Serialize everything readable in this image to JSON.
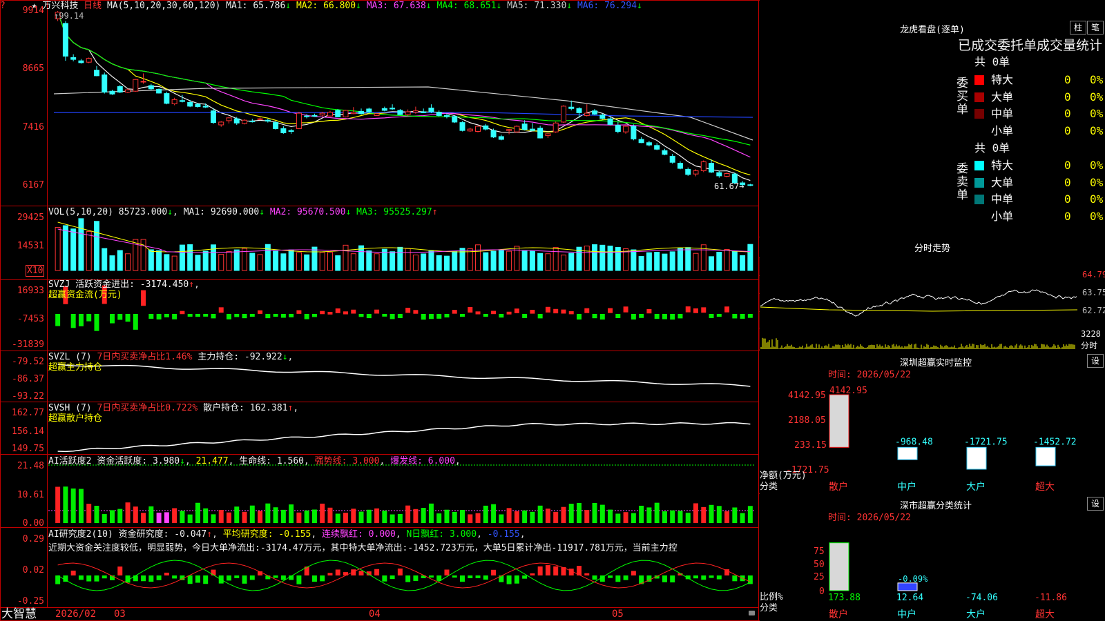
{
  "stock": {
    "star": "★",
    "name": "万兴科技",
    "period": "日线"
  },
  "ma_line": {
    "params": "MA(5,10,20,30,60,120)",
    "items": [
      {
        "label": "MA1: 65.786",
        "arrow": "↓",
        "color": "#f0f0f0"
      },
      {
        "label": "MA2: 66.800",
        "arrow": "↓",
        "color": "#ffff00"
      },
      {
        "label": "MA3: 67.638",
        "arrow": "↓",
        "color": "#ff44ff"
      },
      {
        "label": "MA4: 68.651",
        "arrow": "↓",
        "color": "#00ff00"
      },
      {
        "label": "MA5: 71.330",
        "arrow": "↓",
        "color": "#cccccc"
      },
      {
        "label": "MA6: 76.294",
        "arrow": "↓",
        "color": "#3355ff"
      }
    ]
  },
  "high_mark": "99.14",
  "low_mark": "61.67",
  "price_axis": [
    "9914",
    "8665",
    "7416",
    "6167"
  ],
  "vol": {
    "params": "VOL(5,10,20)",
    "value": "85723.000",
    "arrow": "↓",
    "items": [
      {
        "label": "MA1: 92690.000",
        "arrow": "↓",
        "color": "#f0f0f0"
      },
      {
        "label": "MA2: 95670.500",
        "arrow": "↓",
        "color": "#ff44ff"
      },
      {
        "label": "MA3: 95525.297",
        "arrow": "↑",
        "color": "#00ff00"
      }
    ],
    "axis": [
      "29425",
      "14531"
    ],
    "unit": "X10"
  },
  "svzj": {
    "params": "SVZJ",
    "label": "活跃资金进出: -3174.450",
    "arrow": "↑",
    "sub": "超赢资金流(万元)",
    "axis": [
      "16933",
      "-7453",
      "-31839"
    ]
  },
  "svzl": {
    "params": "SVZL (7)",
    "red": "7日内买卖净占比1.46%",
    "label": "主力持仓: -92.922",
    "arrow": "↓",
    "sub": "超赢主力持仓",
    "axis": [
      "-79.52",
      "-86.37",
      "-93.22"
    ]
  },
  "svsh": {
    "params": "SVSH (7)",
    "red": "7日内买卖净占比0.722%",
    "label": "散户持仓: 162.381",
    "arrow": "↑",
    "sub": "超赢散户持仓",
    "axis": [
      "162.77",
      "156.14",
      "149.75"
    ]
  },
  "ai_active": {
    "params": "AI活跃度2",
    "label": "资金活跃度: 3.980",
    "arrow": "↓",
    "v2": "21.477",
    "v3": "生命线: 1.560",
    "v4": "强势线: 3.000",
    "v5": "爆发线: 6.000",
    "axis": [
      "21.48",
      "10.61",
      "0.00"
    ]
  },
  "ai_research": {
    "params": "AI研究度2(10)",
    "label": "资金研究度: -0.047",
    "arrow": "↑",
    "v2": "平均研究度: -0.155",
    "v3": "连续飘红: 0.000",
    "v4": "N日飘红: 3.000",
    "v5": "-0.155",
    "comment": "近期大资金关注度较低，明显弱势，今日大单净流出:-3174.47万元，其中特大单净流出:-1452.723万元，大单5日累计净出-11917.781万元，当前主力控",
    "axis": [
      "0.29",
      "0.02",
      "-0.25"
    ]
  },
  "date_axis": {
    "brand": "大智慧",
    "labels": [
      "2026/02",
      "03",
      "04",
      "05"
    ]
  },
  "lhb": {
    "title": "龙虎看盘(逐单)",
    "btn1": "柱",
    "btn2": "笔",
    "header": "已成交委托单成交量统计",
    "buy": {
      "side": "委买单",
      "total": "共 0单",
      "rows": [
        {
          "name": "特大",
          "count": "0",
          "pct": "0%",
          "color": "#ff0000"
        },
        {
          "name": "大单",
          "count": "0",
          "pct": "0%",
          "color": "#aa0000"
        },
        {
          "name": "中单",
          "count": "0",
          "pct": "0%",
          "color": "#770000"
        },
        {
          "name": "小单",
          "count": "0",
          "pct": "0%",
          "color": ""
        }
      ]
    },
    "sell": {
      "side": "委卖单",
      "total": "共 0单",
      "rows": [
        {
          "name": "特大",
          "count": "0",
          "pct": "0%",
          "color": "#00ffff"
        },
        {
          "name": "大单",
          "count": "0",
          "pct": "0%",
          "color": "#009999"
        },
        {
          "name": "中单",
          "count": "0",
          "pct": "0%",
          "color": "#007777"
        },
        {
          "name": "小单",
          "count": "0",
          "pct": "0%",
          "color": ""
        }
      ]
    }
  },
  "intraday": {
    "title": "分时走势",
    "axis": [
      "64.79",
      "63.75",
      "62.72",
      "3228"
    ],
    "unit": "分时"
  },
  "sz_monitor": {
    "title": "深圳超赢实时监控",
    "btn": "设",
    "time": "时间: 2026/05/22",
    "axis": [
      "4142.95",
      "2188.05",
      "233.15",
      "-1721.75"
    ],
    "ylabel": "净额(万元)",
    "xlabel": "分类"
  },
  "sz_class": {
    "title": "深市超赢分类统计",
    "btn": "设",
    "time": "时间: 2026/05/22",
    "axis": [
      "75",
      "50",
      "25",
      "0"
    ],
    "ylabel": "比例%",
    "xlabel": "分类",
    "pct_label": "-0.09%"
  },
  "chart_data": [
    {
      "type": "candlestick",
      "title": "万兴科技 日线",
      "y_axis_ticks": [
        99.14,
        86.65,
        74.16,
        61.67
      ],
      "high": 99.14,
      "low": 61.67,
      "candles": [
        [
          97.5,
          99.14,
          97.0,
          98.9
        ],
        [
          96.5,
          97.0,
          88.5,
          89.5
        ],
        [
          89.2,
          89.9,
          88.4,
          88.8
        ],
        [
          88.5,
          88.9,
          87.9,
          88.1
        ],
        [
          88.2,
          89.2,
          88.0,
          89.0
        ],
        [
          86.5,
          87.4,
          85.2,
          85.3
        ],
        [
          85.5,
          86.0,
          81.5,
          81.8
        ],
        [
          82.0,
          82.3,
          81.2,
          81.4
        ],
        [
          83.0,
          83.3,
          81.6,
          81.8
        ],
        [
          81.8,
          82.6,
          81.6,
          82.3
        ],
        [
          82.0,
          84.6,
          81.9,
          84.5
        ],
        [
          84.0,
          85.8,
          83.6,
          84.1
        ],
        [
          83.2,
          83.6,
          82.2,
          82.5
        ],
        [
          82.4,
          82.6,
          81.5,
          81.6
        ],
        [
          81.5,
          81.9,
          79.2,
          79.4
        ],
        [
          79.3,
          80.6,
          79.0,
          80.2
        ],
        [
          80.0,
          81.2,
          79.6,
          79.8
        ],
        [
          79.6,
          80.1,
          78.6,
          78.8
        ],
        [
          79.2,
          79.5,
          78.5,
          78.7
        ],
        [
          78.8,
          79.4,
          78.4,
          78.6
        ],
        [
          77.8,
          78.3,
          75.0,
          75.3
        ],
        [
          74.8,
          75.6,
          74.4,
          75.4
        ],
        [
          75.7,
          76.5,
          75.1,
          76.3
        ],
        [
          76.1,
          76.5,
          74.8,
          75.2
        ],
        [
          75.1,
          76.0,
          74.9,
          75.8
        ],
        [
          75.6,
          76.1,
          75.3,
          75.5
        ],
        [
          76.0,
          76.4,
          75.8,
          76.1
        ],
        [
          75.8,
          76.1,
          75.3,
          75.6
        ],
        [
          75.3,
          75.6,
          73.8,
          74.0
        ],
        [
          74.0,
          74.5,
          72.9,
          73.1
        ],
        [
          73.6,
          73.9,
          72.9,
          73.4
        ],
        [
          74.0,
          77.6,
          73.9,
          77.3
        ],
        [
          76.7,
          77.1,
          76.2,
          76.6
        ],
        [
          76.8,
          77.2,
          76.5,
          76.7
        ],
        [
          76.9,
          77.6,
          76.6,
          77.3
        ],
        [
          76.7,
          77.8,
          76.6,
          77.5
        ],
        [
          77.9,
          78.2,
          76.4,
          76.5
        ],
        [
          76.5,
          78.0,
          76.4,
          77.9
        ],
        [
          77.2,
          78.6,
          77.1,
          77.5
        ],
        [
          77.7,
          78.3,
          77.0,
          77.2
        ],
        [
          78.2,
          78.5,
          77.3,
          77.6
        ],
        [
          76.8,
          77.3,
          76.7,
          77.2
        ],
        [
          78.3,
          78.7,
          77.7,
          77.9
        ],
        [
          78.4,
          79.2,
          78.0,
          78.2
        ],
        [
          77.9,
          78.2,
          76.9,
          77.0
        ],
        [
          77.0,
          78.1,
          76.7,
          77.6
        ],
        [
          77.5,
          78.7,
          77.2,
          77.8
        ],
        [
          77.6,
          78.3,
          77.3,
          77.4
        ],
        [
          78.4,
          79.2,
          77.3,
          77.6
        ],
        [
          77.5,
          77.9,
          76.6,
          76.8
        ],
        [
          76.8,
          77.2,
          76.2,
          76.6
        ],
        [
          76.6,
          76.9,
          75.2,
          75.4
        ],
        [
          75.3,
          75.6,
          73.4,
          73.6
        ],
        [
          73.5,
          74.2,
          73.3,
          73.9
        ],
        [
          73.4,
          74.6,
          73.2,
          74.5
        ],
        [
          74.6,
          75.0,
          73.6,
          73.9
        ],
        [
          73.6,
          74.0,
          72.0,
          72.2
        ],
        [
          72.3,
          72.7,
          71.5,
          71.7
        ],
        [
          73.6,
          73.9,
          72.8,
          73.8
        ],
        [
          73.3,
          74.7,
          73.1,
          74.5
        ],
        [
          75.0,
          75.8,
          73.6,
          73.8
        ],
        [
          73.9,
          75.2,
          73.5,
          73.6
        ],
        [
          74.1,
          74.6,
          71.9,
          72.0
        ],
        [
          72.5,
          73.0,
          72.0,
          72.9
        ],
        [
          73.3,
          75.5,
          73.1,
          75.2
        ],
        [
          75.4,
          79.0,
          75.2,
          78.8
        ],
        [
          78.6,
          80.0,
          77.9,
          78.3
        ],
        [
          78.3,
          78.6,
          76.3,
          77.4
        ],
        [
          76.8,
          79.2,
          76.6,
          77.3
        ],
        [
          77.8,
          78.2,
          76.9,
          77.1
        ],
        [
          76.9,
          77.2,
          76.0,
          76.2
        ],
        [
          76.1,
          76.5,
          74.7,
          74.9
        ],
        [
          74.7,
          75.5,
          73.0,
          73.4
        ],
        [
          73.3,
          74.8,
          72.9,
          74.5
        ],
        [
          74.5,
          74.9,
          71.5,
          71.8
        ],
        [
          71.7,
          72.2,
          70.9,
          71.0
        ],
        [
          71.0,
          71.4,
          70.2,
          70.5
        ],
        [
          70.4,
          70.9,
          69.4,
          69.6
        ],
        [
          69.3,
          69.7,
          68.3,
          68.5
        ],
        [
          68.1,
          68.6,
          66.5,
          66.8
        ],
        [
          66.6,
          67.0,
          65.3,
          65.5
        ],
        [
          65.3,
          65.7,
          63.9,
          64.2
        ],
        [
          64.3,
          65.3,
          63.8,
          65.0
        ],
        [
          65.0,
          67.2,
          64.7,
          66.9
        ],
        [
          66.6,
          67.4,
          64.5,
          64.7
        ],
        [
          64.6,
          65.0,
          63.5,
          63.9
        ],
        [
          63.8,
          64.6,
          63.6,
          64.4
        ],
        [
          64.3,
          64.6,
          62.1,
          62.4
        ],
        [
          62.4,
          62.8,
          61.67,
          62.0
        ],
        [
          62.0,
          62.2,
          61.7,
          61.9
        ]
      ]
    },
    {
      "type": "bar",
      "title": "VOL(5,10,20)",
      "y_axis_ticks": [
        29425,
        14531
      ]
    },
    {
      "type": "bar",
      "title": "SVZJ 超赢资金流(万元)",
      "y_axis_ticks": [
        16933,
        -7453,
        -31839
      ]
    },
    {
      "type": "line",
      "title": "SVZL 超赢主力持仓",
      "y_axis_ticks": [
        -79.52,
        -86.37,
        -93.22
      ]
    },
    {
      "type": "line",
      "title": "SVSH 超赢散户持仓",
      "y_axis_ticks": [
        162.77,
        156.14,
        149.75
      ]
    },
    {
      "type": "bar",
      "title": "AI活跃度2",
      "y_axis_ticks": [
        21.48,
        10.61,
        0.0
      ]
    },
    {
      "type": "bar",
      "title": "AI研究度2(10)",
      "y_axis_ticks": [
        0.29,
        0.02,
        -0.25
      ]
    },
    {
      "type": "line",
      "title": "分时走势",
      "y_axis_ticks": [
        64.79,
        63.75,
        62.72
      ]
    },
    {
      "type": "bar",
      "title": "深圳超赢实时监控",
      "categories": [
        "散户",
        "中户",
        "大户",
        "超大"
      ],
      "values": [
        4142.95,
        -968.48,
        -1721.75,
        -1452.72
      ],
      "labels": [
        "4142.95",
        "-968.48",
        "-1721.75",
        "-1452.72"
      ],
      "ylim": [
        -1721.75,
        4142.95
      ]
    },
    {
      "type": "bar",
      "title": "深市超赢分类统计",
      "categories": [
        "散户",
        "中户",
        "大户",
        "超大"
      ],
      "values": [
        173.88,
        12.64,
        -74.06,
        -11.86
      ],
      "labels": [
        "173.88",
        "12.64",
        "-74.06",
        "-11.86"
      ],
      "ylim": [
        0,
        75
      ]
    }
  ]
}
